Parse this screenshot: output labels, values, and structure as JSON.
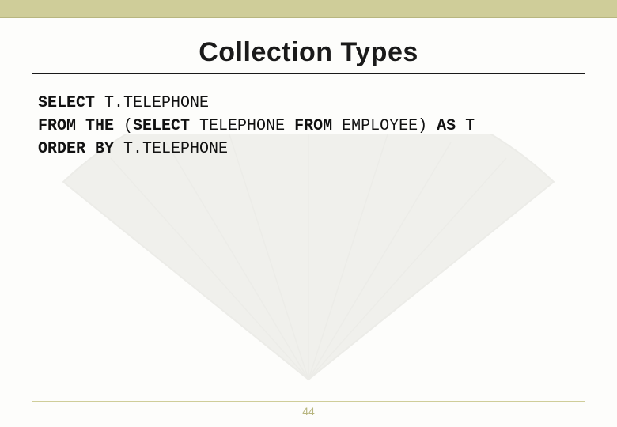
{
  "slide": {
    "title": "Collection Types",
    "code": {
      "line1_kw": "SELECT",
      "line1_rest": " T.TELEPHONE",
      "line2_kw1": "FROM THE",
      "line2_mid": " (",
      "line2_kw2": "SELECT",
      "line2_mid2": " TELEPHONE ",
      "line2_kw3": "FROM",
      "line2_mid3": " EMPLOYEE) ",
      "line2_kw4": "AS",
      "line2_rest": " T",
      "line3_kw": "ORDER BY",
      "line3_rest": " T.TELEPHONE"
    },
    "page_number": "44"
  }
}
